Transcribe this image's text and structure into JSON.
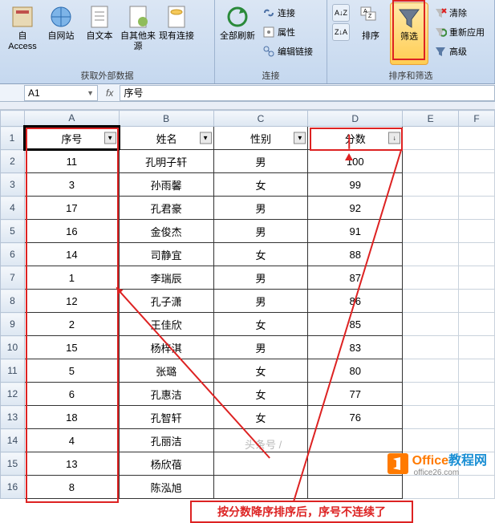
{
  "ribbon": {
    "group1_label": "获取外部数据",
    "btn_access": "自 Access",
    "btn_web": "自网站",
    "btn_text": "自文本",
    "btn_other": "自其他来源",
    "btn_exist": "现有连接",
    "group2_label": "连接",
    "btn_refresh": "全部刷新",
    "btn_conn": "连接",
    "btn_prop": "属性",
    "btn_editlink": "编辑链接",
    "group3_label": "排序和筛选",
    "btn_sort": "排序",
    "btn_filter": "筛选",
    "btn_clear": "清除",
    "btn_reapply": "重新应用",
    "btn_adv": "高级"
  },
  "namebox": "A1",
  "formula": "序号",
  "cols": [
    "A",
    "B",
    "C",
    "D",
    "E",
    "F"
  ],
  "headers": {
    "a": "序号",
    "b": "姓名",
    "c": "性别",
    "d": "分数"
  },
  "rows": [
    {
      "n": "1",
      "a": "序号",
      "b": "姓名",
      "c": "性别",
      "d": "分数",
      "hdr": true
    },
    {
      "n": "2",
      "a": "11",
      "b": "孔明子轩",
      "c": "男",
      "d": "100"
    },
    {
      "n": "3",
      "a": "3",
      "b": "孙雨馨",
      "c": "女",
      "d": "99"
    },
    {
      "n": "4",
      "a": "17",
      "b": "孔君豪",
      "c": "男",
      "d": "92"
    },
    {
      "n": "5",
      "a": "16",
      "b": "金俊杰",
      "c": "男",
      "d": "91"
    },
    {
      "n": "6",
      "a": "14",
      "b": "司静宜",
      "c": "女",
      "d": "88"
    },
    {
      "n": "7",
      "a": "1",
      "b": "李瑞辰",
      "c": "男",
      "d": "87"
    },
    {
      "n": "8",
      "a": "12",
      "b": "孔子潇",
      "c": "男",
      "d": "86"
    },
    {
      "n": "9",
      "a": "2",
      "b": "王佳欣",
      "c": "女",
      "d": "85"
    },
    {
      "n": "10",
      "a": "15",
      "b": "杨梓淇",
      "c": "男",
      "d": "83"
    },
    {
      "n": "11",
      "a": "5",
      "b": "张璐",
      "c": "女",
      "d": "80"
    },
    {
      "n": "12",
      "a": "6",
      "b": "孔惠洁",
      "c": "女",
      "d": "77"
    },
    {
      "n": "13",
      "a": "18",
      "b": "孔智轩",
      "c": "女",
      "d": "76"
    },
    {
      "n": "14",
      "a": "4",
      "b": "孔丽洁",
      "c": "",
      "d": ""
    },
    {
      "n": "15",
      "a": "13",
      "b": "杨欣蓓",
      "c": "",
      "d": ""
    },
    {
      "n": "16",
      "a": "8",
      "b": "陈泓旭",
      "c": "",
      "d": ""
    }
  ],
  "callout": "按分数降序排序后，序号不连续了",
  "watermark1": "头条号 /",
  "wm_office": "Office",
  "wm_tutorial": "教程网",
  "wm_url": "office26.com"
}
